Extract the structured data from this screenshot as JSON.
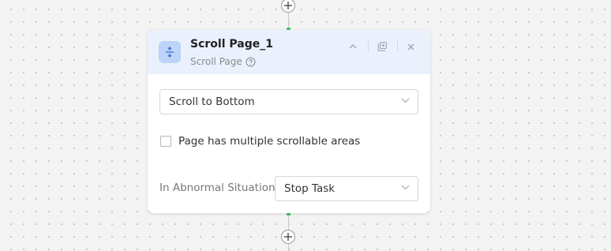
{
  "node": {
    "title": "Scroll Page_1",
    "subtitle": "Scroll Page",
    "icon": "scroll-vertical-icon"
  },
  "header_actions": [
    "collapse-icon",
    "copy-icon",
    "close-icon"
  ],
  "scroll_mode": {
    "selected": "Scroll to Bottom"
  },
  "multiple_areas": {
    "label": "Page has multiple scrollable areas",
    "checked": false
  },
  "abnormal": {
    "label": "In Abnormal Situation",
    "selected": "Stop Task"
  },
  "colors": {
    "header_bg": "#ebf1fc",
    "icon_bg": "#bcd4f7",
    "icon_fg": "#3a6fd8",
    "connector_accent": "#35c46a"
  }
}
